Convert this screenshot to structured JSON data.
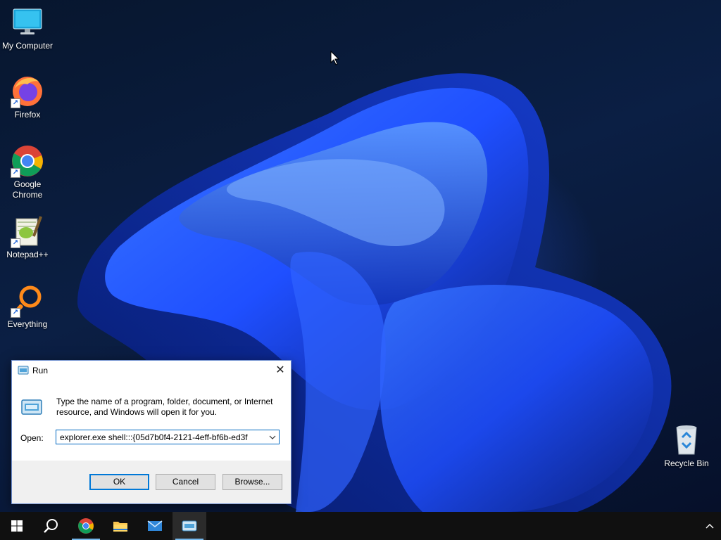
{
  "desktop": {
    "icons": [
      {
        "label": "My Computer",
        "icon": "monitor-icon",
        "shortcut": false
      },
      {
        "label": "Firefox",
        "icon": "firefox-icon",
        "shortcut": true
      },
      {
        "label": "Google Chrome",
        "icon": "chrome-icon",
        "shortcut": true
      },
      {
        "label": "Notepad++",
        "icon": "notepadpp-icon",
        "shortcut": true
      },
      {
        "label": "Everything",
        "icon": "everything-icon",
        "shortcut": true
      },
      {
        "label": "Recycle Bin",
        "icon": "recycle-bin-icon",
        "shortcut": false
      }
    ]
  },
  "run_dialog": {
    "title": "Run",
    "description": "Type the name of a program, folder, document, or Internet resource, and Windows will open it for you.",
    "open_label": "Open:",
    "open_value": "explorer.exe shell:::{05d7b0f4-2121-4eff-bf6b-ed3f",
    "buttons": {
      "ok": "OK",
      "cancel": "Cancel",
      "browse": "Browse..."
    },
    "close_glyph": "✕"
  },
  "taskbar": {
    "items": [
      {
        "name": "start",
        "icon": "windows-logo-icon",
        "active": false
      },
      {
        "name": "search",
        "icon": "search-icon",
        "active": false
      },
      {
        "name": "chrome",
        "icon": "chrome-icon",
        "active": false,
        "running": true
      },
      {
        "name": "file-explorer",
        "icon": "folder-icon",
        "active": false
      },
      {
        "name": "mail",
        "icon": "mail-icon",
        "active": false
      },
      {
        "name": "run",
        "icon": "run-icon",
        "active": true,
        "running": true
      }
    ]
  },
  "colors": {
    "accent": "#0078d7",
    "taskbar": "#101010",
    "dialog_footer": "#f0f0f0",
    "wallpaper_bloom": "#1f4fff"
  }
}
